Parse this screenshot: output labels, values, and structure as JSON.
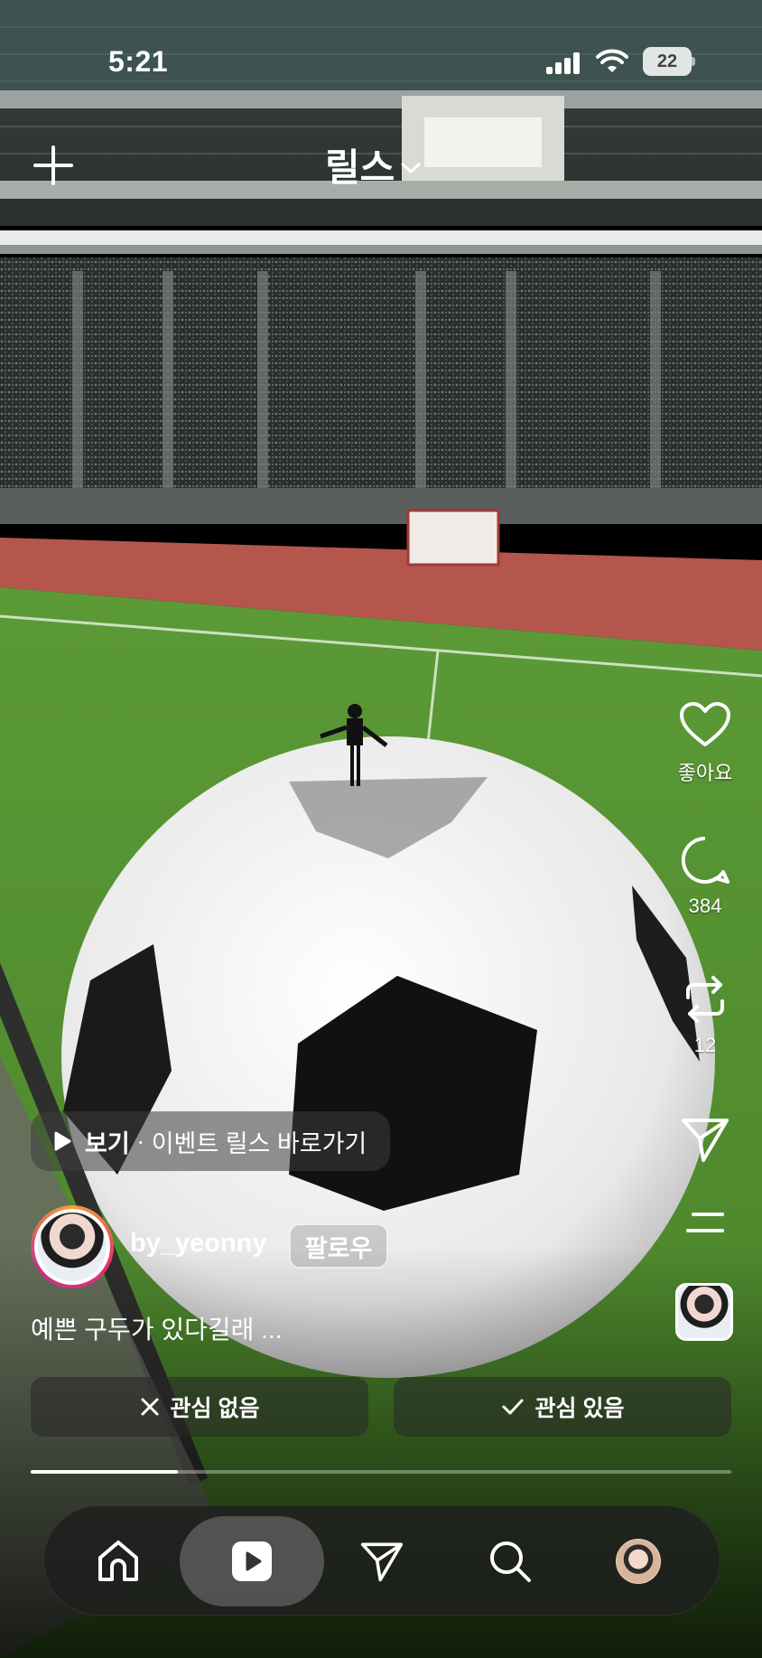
{
  "status_bar": {
    "time": "5:21",
    "battery": "22"
  },
  "header": {
    "title": "릴스",
    "plus_icon": "plus-icon",
    "chevron_icon": "chevron-down-icon"
  },
  "actions": {
    "like_label": "좋아요",
    "comment_count": "384",
    "repost_count": "12"
  },
  "event": {
    "strong": "보기",
    "separator": " · ",
    "text": "이벤트 릴스 바로가기"
  },
  "author": {
    "username": "by_yeonny",
    "follow_label": "팔로우"
  },
  "caption": "예쁜 구두가 있다길래 ...",
  "feedback": {
    "not_interested": "관심 없음",
    "interested": "관심 있음"
  },
  "playback": {
    "progress": 0.21
  },
  "nav": {
    "items": [
      "home-icon",
      "reels-icon",
      "send-icon",
      "search-icon",
      "profile-avatar"
    ],
    "active": "reels-icon"
  },
  "colors": {
    "pitch": "#4f8a2e",
    "track": "#b5564c",
    "ring_start": "#f9a13a",
    "ring_end": "#c13584"
  }
}
